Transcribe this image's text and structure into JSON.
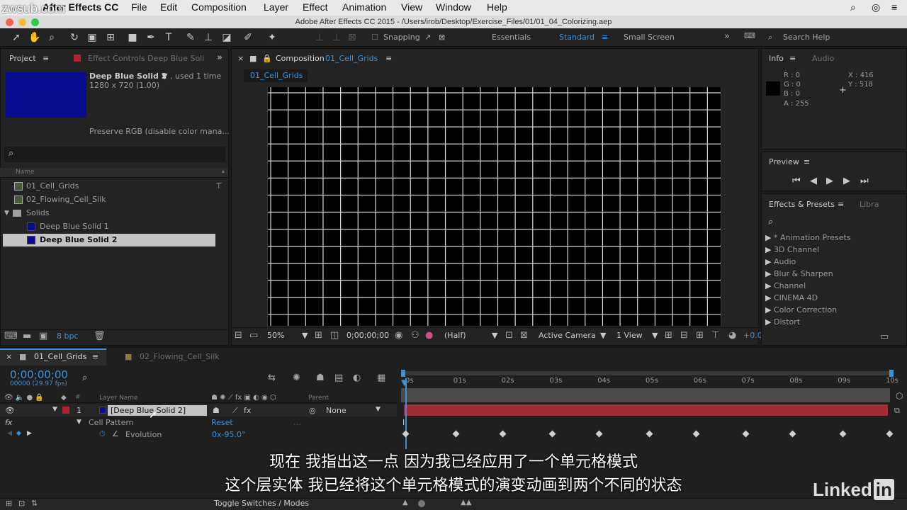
{
  "watermark": "zwsub.com",
  "menubar": {
    "app": "After Effects CC",
    "items": [
      "File",
      "Edit",
      "Composition",
      "Layer",
      "Effect",
      "Animation",
      "View",
      "Window",
      "Help"
    ]
  },
  "window_title": "Adobe After Effects CC 2015 - /Users/irob/Desktop/Exercise_Files/01/01_04_Colorizing.aep",
  "toolbar": {
    "snapping": "Snapping",
    "workspaces": [
      "Essentials",
      "Standard",
      "Small Screen"
    ],
    "search_help": "Search Help"
  },
  "project": {
    "tab_project": "Project",
    "tab_effect_controls": "Effect Controls Deep Blue Soli",
    "selected_name": "Deep Blue Solid 2",
    "used": ", used 1 time",
    "dimensions": "1280 x 720 (1.00)",
    "preserve": "Preserve RGB (disable color mana...",
    "col_name": "Name",
    "items": [
      "01_Cell_Grids",
      "02_Flowing_Cell_Silk",
      "Solids",
      "Deep Blue Solid 1",
      "Deep Blue Solid 2"
    ],
    "bpc": "8 bpc"
  },
  "composition": {
    "tab": "Composition",
    "tab_name": "01_Cell_Grids",
    "breadcrumb": "01_Cell_Grids",
    "zoom": "50%",
    "timecode": "0;00;00;00",
    "resolution": "(Half)",
    "camera": "Active Camera",
    "views": "1 View",
    "exposure": "+0.0"
  },
  "info": {
    "tab": "Info",
    "tab_audio": "Audio",
    "r": "R : 0",
    "g": "G : 0",
    "b": "B : 0",
    "a": "A : 255",
    "x": "X : 416",
    "y": "Y : 518"
  },
  "preview": {
    "title": "Preview"
  },
  "effects": {
    "tab": "Effects & Presets",
    "tab_libra": "Libra",
    "items": [
      "* Animation Presets",
      "3D Channel",
      "Audio",
      "Blur & Sharpen",
      "Channel",
      "CINEMA 4D",
      "Color Correction",
      "Distort"
    ]
  },
  "timeline": {
    "tab1": "01_Cell_Grids",
    "tab2": "02_Flowing_Cell_Silk",
    "timecode": "0;00;00;00",
    "fps": "00000 (29.97 fps)",
    "col_layer_name": "Layer Name",
    "col_parent": "Parent",
    "layer_num": "1",
    "layer_name": "[Deep Blue Solid 2]",
    "parent": "None",
    "effect_name": "Cell Pattern",
    "reset": "Reset",
    "property": "Evolution",
    "property_value": "0x-95.0°",
    "ticks": [
      "0s",
      "01s",
      "02s",
      "03s",
      "04s",
      "05s",
      "06s",
      "07s",
      "08s",
      "09s",
      "10s"
    ],
    "toggle": "Toggle Switches / Modes"
  },
  "subtitles": {
    "line1": "现在  我指出这一点  因为我已经应用了一个单元格模式",
    "line2": "这个层实体  我已经将这个单元格模式的演变动画到两个不同的状态"
  },
  "linkedin": {
    "text": "Linked",
    "in": "in"
  },
  "colors": {
    "accent": "#3d8fd6",
    "solid": "#0a0c8f",
    "layer_bar": "#a32c3a"
  }
}
